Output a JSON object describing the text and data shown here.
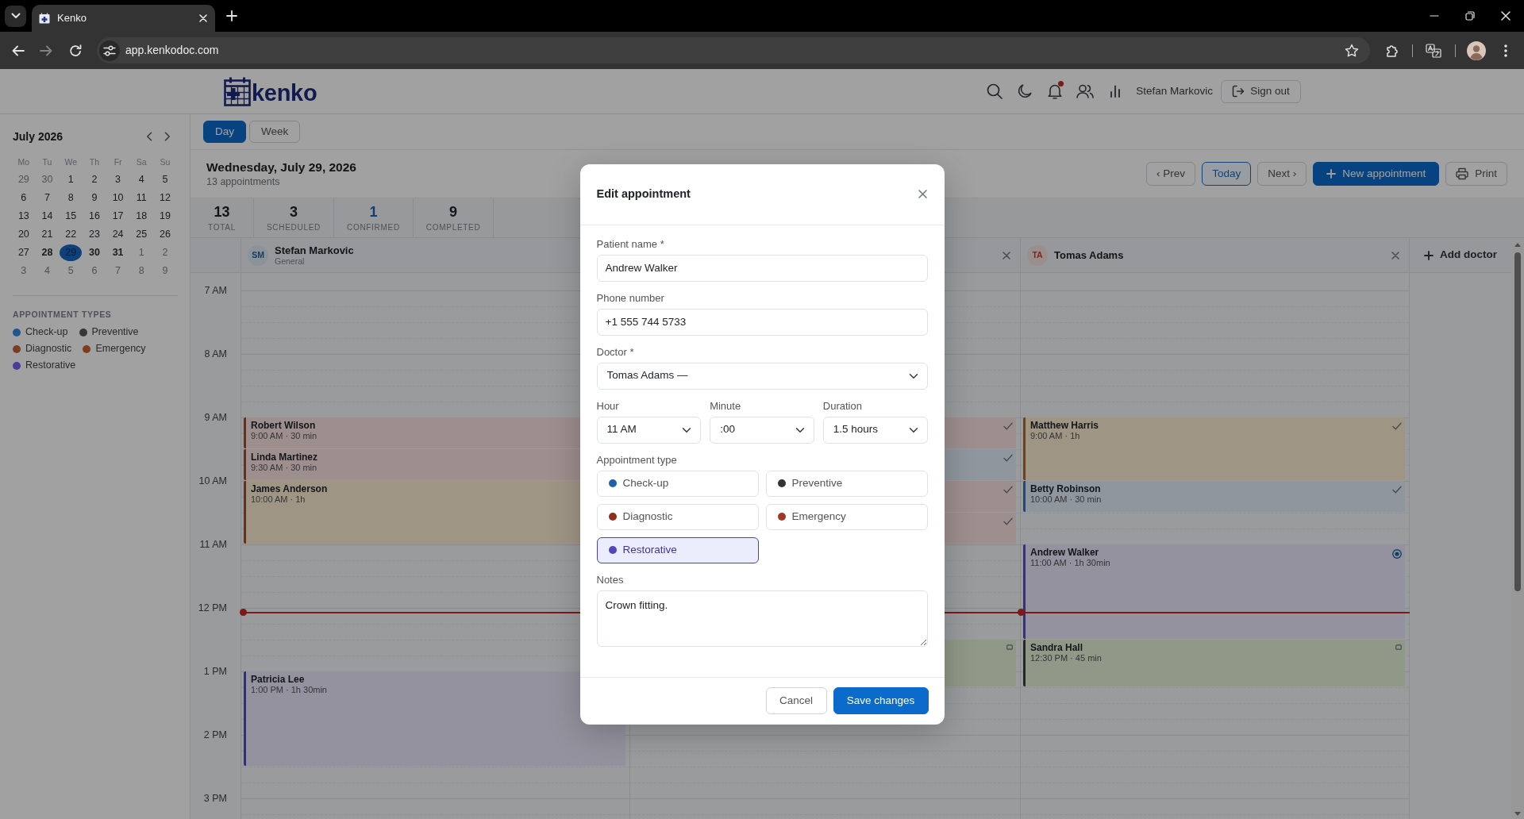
{
  "browser": {
    "tab_title": "Kenko",
    "url": "app.kenkodoc.com",
    "can_go_forward": false
  },
  "header": {
    "logo_text": "kenko",
    "user_name": "Stefan Markovic",
    "sign_out": "Sign out",
    "notifications_unread": true
  },
  "sidebar": {
    "month": "July 2026",
    "weekdays": [
      "Mo",
      "Tu",
      "We",
      "Th",
      "Fr",
      "Sa",
      "Su"
    ],
    "weeks": [
      [
        {
          "day": "29",
          "other_month": true,
          "bold": false,
          "selected": false
        },
        {
          "day": "30",
          "other_month": true,
          "bold": false,
          "selected": false
        },
        {
          "day": "1",
          "other_month": false,
          "bold": false,
          "selected": false
        },
        {
          "day": "2",
          "other_month": false,
          "bold": false,
          "selected": false
        },
        {
          "day": "3",
          "other_month": false,
          "bold": false,
          "selected": false
        },
        {
          "day": "4",
          "other_month": false,
          "bold": false,
          "selected": false
        },
        {
          "day": "5",
          "other_month": false,
          "bold": false,
          "selected": false
        }
      ],
      [
        {
          "day": "6",
          "other_month": false,
          "bold": false,
          "selected": false
        },
        {
          "day": "7",
          "other_month": false,
          "bold": false,
          "selected": false
        },
        {
          "day": "8",
          "other_month": false,
          "bold": false,
          "selected": false
        },
        {
          "day": "9",
          "other_month": false,
          "bold": false,
          "selected": false
        },
        {
          "day": "10",
          "other_month": false,
          "bold": false,
          "selected": false
        },
        {
          "day": "11",
          "other_month": false,
          "bold": false,
          "selected": false
        },
        {
          "day": "12",
          "other_month": false,
          "bold": false,
          "selected": false
        }
      ],
      [
        {
          "day": "13",
          "other_month": false,
          "bold": false,
          "selected": false
        },
        {
          "day": "14",
          "other_month": false,
          "bold": false,
          "selected": false
        },
        {
          "day": "15",
          "other_month": false,
          "bold": false,
          "selected": false
        },
        {
          "day": "16",
          "other_month": false,
          "bold": false,
          "selected": false
        },
        {
          "day": "17",
          "other_month": false,
          "bold": false,
          "selected": false
        },
        {
          "day": "18",
          "other_month": false,
          "bold": false,
          "selected": false
        },
        {
          "day": "19",
          "other_month": false,
          "bold": false,
          "selected": false
        }
      ],
      [
        {
          "day": "20",
          "other_month": false,
          "bold": false,
          "selected": false
        },
        {
          "day": "21",
          "other_month": false,
          "bold": false,
          "selected": false
        },
        {
          "day": "22",
          "other_month": false,
          "bold": false,
          "selected": false
        },
        {
          "day": "23",
          "other_month": false,
          "bold": false,
          "selected": false
        },
        {
          "day": "24",
          "other_month": false,
          "bold": false,
          "selected": false
        },
        {
          "day": "25",
          "other_month": false,
          "bold": false,
          "selected": false
        },
        {
          "day": "26",
          "other_month": false,
          "bold": false,
          "selected": false
        }
      ],
      [
        {
          "day": "27",
          "other_month": false,
          "bold": false,
          "selected": false
        },
        {
          "day": "28",
          "other_month": false,
          "bold": true,
          "selected": false
        },
        {
          "day": "29",
          "other_month": false,
          "bold": false,
          "selected": true
        },
        {
          "day": "30",
          "other_month": false,
          "bold": true,
          "selected": false
        },
        {
          "day": "31",
          "other_month": false,
          "bold": true,
          "selected": false
        },
        {
          "day": "1",
          "other_month": true,
          "bold": false,
          "selected": false
        },
        {
          "day": "2",
          "other_month": true,
          "bold": false,
          "selected": false
        }
      ],
      [
        {
          "day": "3",
          "other_month": true,
          "bold": false,
          "selected": false
        },
        {
          "day": "4",
          "other_month": true,
          "bold": false,
          "selected": false
        },
        {
          "day": "5",
          "other_month": true,
          "bold": false,
          "selected": false
        },
        {
          "day": "6",
          "other_month": true,
          "bold": false,
          "selected": false
        },
        {
          "day": "7",
          "other_month": true,
          "bold": false,
          "selected": false
        },
        {
          "day": "8",
          "other_month": true,
          "bold": false,
          "selected": false
        },
        {
          "day": "9",
          "other_month": true,
          "bold": false,
          "selected": false
        }
      ]
    ],
    "legend_title": "APPOINTMENT TYPES",
    "legend": [
      {
        "label": "Check-up",
        "color": "#1f5690"
      },
      {
        "label": "Preventive",
        "color": "#363636"
      },
      {
        "label": "Diagnostic",
        "color": "#7a3d24"
      },
      {
        "label": "Emergency",
        "color": "#7f3a20"
      },
      {
        "label": "Restorative",
        "color": "#4a3d99"
      }
    ]
  },
  "main": {
    "view_tabs": [
      {
        "label": "Day",
        "selected": true
      },
      {
        "label": "Week",
        "selected": false
      }
    ],
    "date_title": "Wednesday, July 29, 2026",
    "appointment_count": "13 appointments",
    "nav_buttons": [
      {
        "label": "‹ Prev",
        "kind": "plain"
      },
      {
        "label": "Today",
        "kind": "outline"
      },
      {
        "label": "Next ›",
        "kind": "plain"
      }
    ],
    "new_appointment": "New appointment",
    "print": "Print",
    "stats": [
      {
        "value": "13",
        "label": "TOTAL",
        "kind": "plain"
      },
      {
        "value": "3",
        "label": "SCHEDULED",
        "kind": "plain"
      },
      {
        "value": "1",
        "label": "CONFIRMED",
        "kind": "accent"
      },
      {
        "value": "9",
        "label": "COMPLETED",
        "kind": "plain"
      }
    ],
    "hours": [
      "7 AM",
      "8 AM",
      "9 AM",
      "10 AM",
      "11 AM",
      "12 PM",
      "1 PM",
      "2 PM",
      "3 PM"
    ],
    "columns": [
      {
        "initials": "SM",
        "name": "Stefan Markovic",
        "specialty": "General",
        "color": "#8b9298",
        "events": [
          {
            "patient": "Robert Wilson",
            "time": "9:00 AM · 30 min",
            "kind": "diagnostic",
            "color": "#6e2d19"
          },
          {
            "patient": "Linda Martinez",
            "time": "9:30 AM · 30 min",
            "kind": "diagnostic",
            "color": "#6e2d19"
          },
          {
            "patient": "James Anderson",
            "time": "10:00 AM · 1h",
            "kind": "emergency",
            "color": "#6e2d19"
          },
          {
            "patient": "Patricia Lee",
            "time": "1:00 PM · 1h 30min",
            "kind": "restorative",
            "color": "#322d8c"
          }
        ]
      },
      {
        "removable": true,
        "events": [
          {
            "kind": "diagnostic",
            "completed": true,
            "confirmed": false,
            "scheduled": false
          },
          {
            "kind": "checkup",
            "completed": true,
            "confirmed": false,
            "scheduled": false
          },
          {
            "kind": "diagnostic",
            "completed": true,
            "confirmed": false,
            "scheduled": false
          },
          {
            "kind": "diagnostic",
            "completed": true,
            "confirmed": false,
            "scheduled": false
          },
          {
            "kind": "preventive",
            "completed": false,
            "confirmed": false,
            "scheduled": true
          }
        ]
      },
      {
        "initials": "TA",
        "name": "Tomas Adams",
        "color": "#9a8f8d",
        "removable": true,
        "events": [
          {
            "patient": "Matthew Harris",
            "time": "9:00 AM · 1h",
            "kind": "emergency",
            "color": "#783c14",
            "completed": true,
            "confirmed": false,
            "scheduled": false
          },
          {
            "patient": "Betty Robinson",
            "time": "10:00 AM · 30 min",
            "kind": "checkup",
            "color": "#1a4b87",
            "completed": true,
            "confirmed": false,
            "scheduled": false
          },
          {
            "patient": "Andrew Walker",
            "time": "11:00 AM · 1h 30min",
            "kind": "restorative",
            "color": "#372d8c",
            "completed": false,
            "confirmed": true,
            "scheduled": false
          },
          {
            "patient": "Sandra Hall",
            "time": "12:30 PM · 45 min",
            "kind": "preventive",
            "color": "#282828",
            "completed": false,
            "confirmed": false,
            "scheduled": true
          }
        ]
      }
    ],
    "add_doctor": "Add doctor"
  },
  "modal": {
    "title": "Edit appointment",
    "fields": [
      {
        "label": "Patient name *",
        "value": "Andrew Walker",
        "kind": "text"
      },
      {
        "label": "Phone number",
        "value": "+1 555 744 5733",
        "kind": "text"
      },
      {
        "label": "Doctor *",
        "value": "Tomas Adams —",
        "kind": "select"
      }
    ],
    "time_fields": [
      {
        "label": "Hour",
        "value": "11 AM"
      },
      {
        "label": "Minute",
        "value": ":00"
      },
      {
        "label": "Duration",
        "value": "1.5 hours"
      }
    ],
    "type_label": "Appointment type",
    "types": [
      {
        "label": "Check-up",
        "color": "#1d63a6",
        "selected": false
      },
      {
        "label": "Preventive",
        "color": "#333333",
        "selected": false
      },
      {
        "label": "Diagnostic",
        "color": "#8f2d1f",
        "selected": false
      },
      {
        "label": "Emergency",
        "color": "#9e3a24",
        "selected": false
      },
      {
        "label": "Restorative",
        "color": "#5246b8",
        "selected": true
      }
    ],
    "notes_label": "Notes",
    "notes": "Crown fitting.",
    "buttons": [
      {
        "label": "Cancel",
        "kind": "secondary"
      },
      {
        "label": "Save changes",
        "kind": "primary"
      }
    ]
  }
}
